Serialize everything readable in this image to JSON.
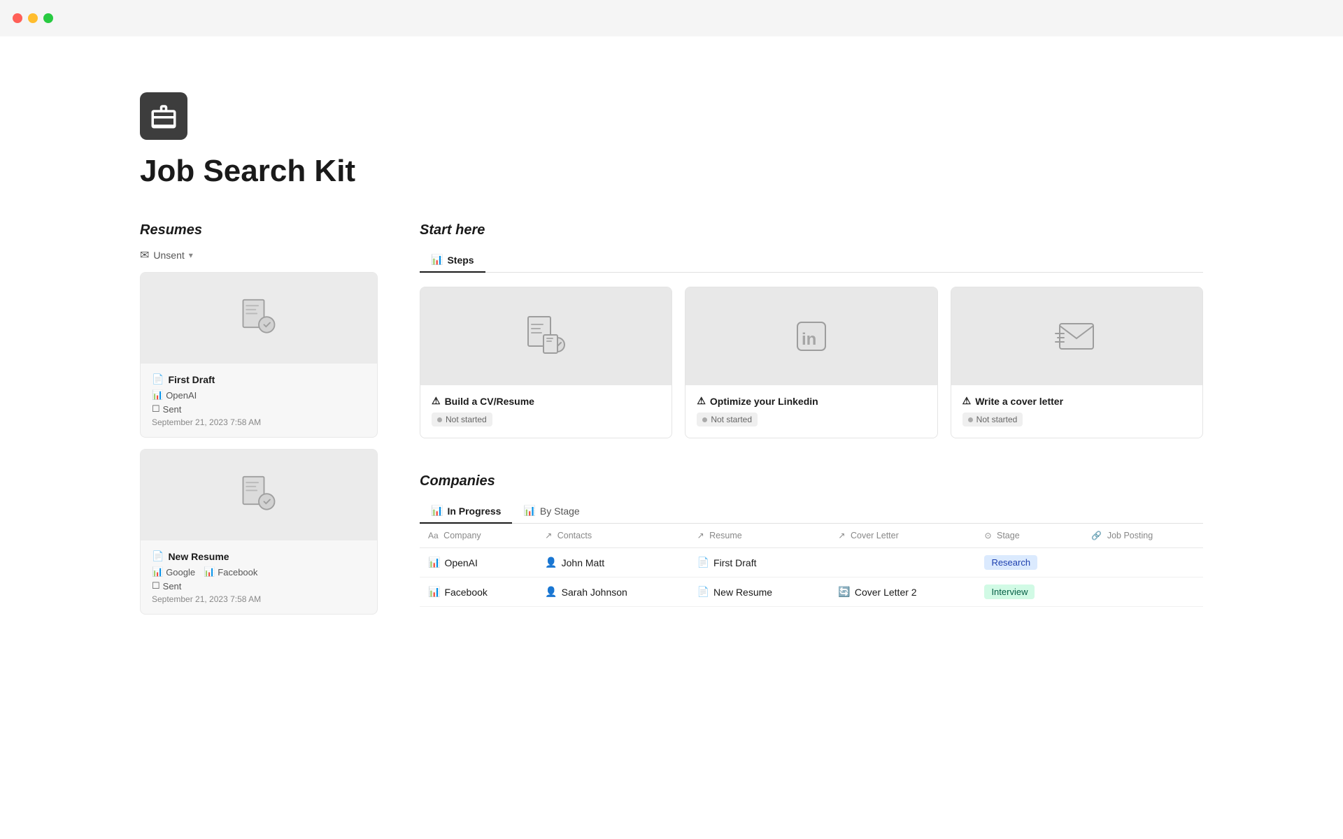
{
  "window": {
    "title": "Job Search Kit"
  },
  "page": {
    "title": "Job Search Kit",
    "icon_label": "briefcase-icon"
  },
  "resumes": {
    "section_label": "Resumes",
    "filter_label": "Unsent",
    "cards": [
      {
        "title": "First Draft",
        "company": "OpenAI",
        "sent": "Sent",
        "date": "September 21, 2023 7:58 AM"
      },
      {
        "title": "New Resume",
        "company": "Google",
        "company2": "Facebook",
        "sent": "Sent",
        "date": "September 21, 2023 7:58 AM"
      }
    ]
  },
  "start_here": {
    "section_label": "Start here",
    "tab_label": "Steps",
    "steps": [
      {
        "title": "Build a CV/Resume",
        "status": "Not started"
      },
      {
        "title": "Optimize your Linkedin",
        "status": "Not started"
      },
      {
        "title": "Write a cover letter",
        "status": "Not started"
      }
    ]
  },
  "companies": {
    "section_label": "Companies",
    "tabs": [
      {
        "label": "In Progress",
        "active": true
      },
      {
        "label": "By Stage",
        "active": false
      }
    ],
    "columns": [
      {
        "label": "Company",
        "icon": "Aa"
      },
      {
        "label": "Contacts",
        "icon": "↗"
      },
      {
        "label": "Resume",
        "icon": "↗"
      },
      {
        "label": "Cover Letter",
        "icon": "↗"
      },
      {
        "label": "Stage",
        "icon": "⊙"
      },
      {
        "label": "Job Posting",
        "icon": "🔗"
      }
    ],
    "rows": [
      {
        "company": "OpenAI",
        "contact": "John Matt",
        "resume": "First Draft",
        "cover_letter": "",
        "stage": "Research",
        "stage_class": "stage-research",
        "job_posting": ""
      },
      {
        "company": "Facebook",
        "contact": "Sarah Johnson",
        "resume": "New Resume",
        "cover_letter": "Cover Letter 2",
        "stage": "Interview",
        "stage_class": "stage-interview",
        "job_posting": ""
      }
    ]
  }
}
